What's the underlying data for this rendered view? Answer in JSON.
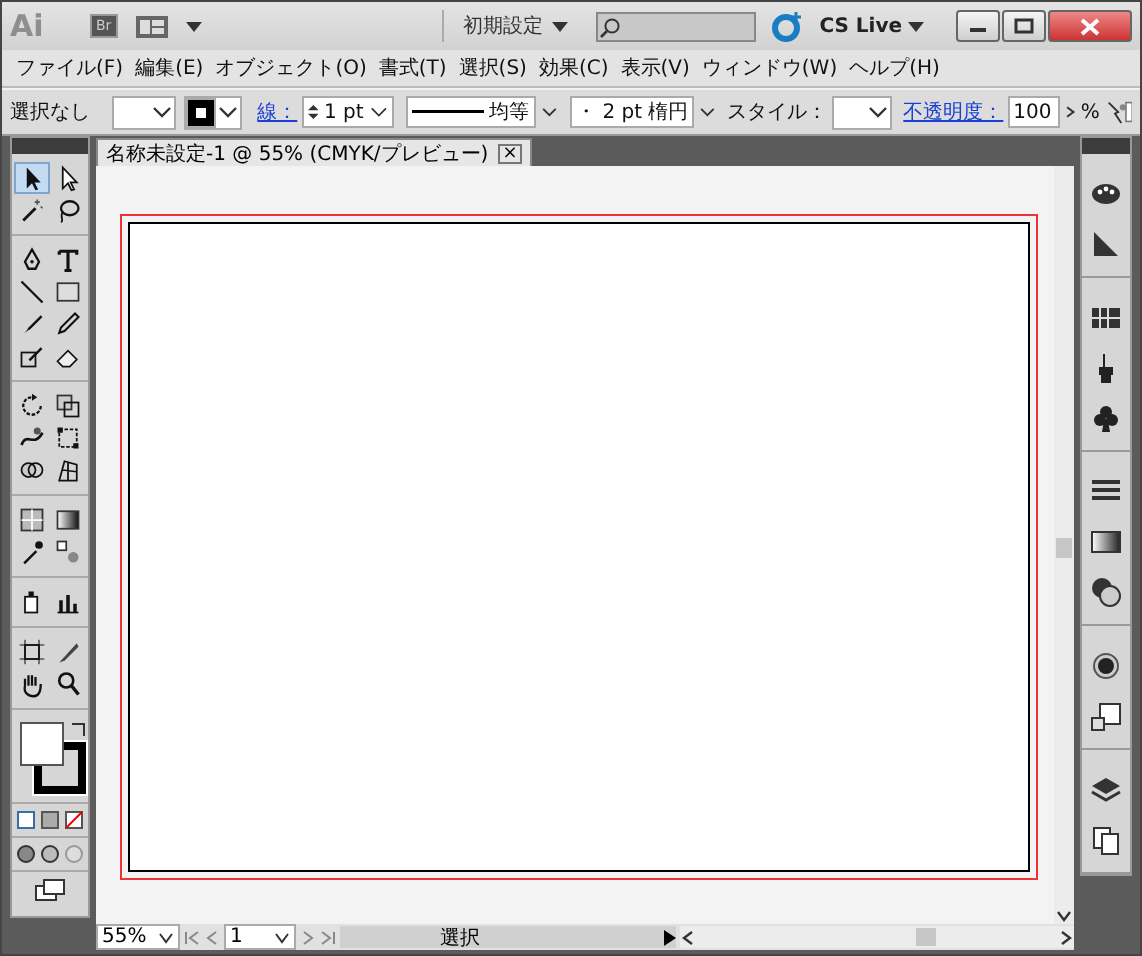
{
  "title_bar": {
    "logo": "Ai",
    "bridge": "Br",
    "workspace": "初期設定",
    "cs_live": "CS Live"
  },
  "menu": [
    "ファイル(F)",
    "編集(E)",
    "オブジェクト(O)",
    "書式(T)",
    "選択(S)",
    "効果(C)",
    "表示(V)",
    "ウィンドウ(W)",
    "ヘルプ(H)"
  ],
  "control_bar": {
    "selection": "選択なし",
    "stroke_link": "線：",
    "stroke_weight": "1 pt",
    "profile": "均等",
    "brush": "・  2 pt 楕円",
    "style_label": "スタイル：",
    "opacity_link": "不透明度：",
    "opacity": "100",
    "opacity_unit": "%"
  },
  "document_tab": {
    "title": "名称未設定-1 @ 55% (CMYK/プレビュー)",
    "close": "×"
  },
  "tool_groups": [
    [
      {
        "kind": "selection",
        "selected": true
      },
      {
        "kind": "direct",
        "selected": false
      },
      {
        "kind": "wand",
        "selected": false
      },
      {
        "kind": "lasso",
        "selected": false
      }
    ],
    [
      {
        "kind": "pen",
        "selected": false
      },
      {
        "kind": "type",
        "selected": false
      },
      {
        "kind": "line",
        "selected": false
      },
      {
        "kind": "rect",
        "selected": false
      },
      {
        "kind": "brush",
        "selected": false
      },
      {
        "kind": "pencil",
        "selected": false
      },
      {
        "kind": "blob",
        "selected": false
      },
      {
        "kind": "eraser",
        "selected": false
      }
    ],
    [
      {
        "kind": "rotate",
        "selected": false
      },
      {
        "kind": "scale",
        "selected": false
      },
      {
        "kind": "warp",
        "selected": false
      },
      {
        "kind": "transform",
        "selected": false
      },
      {
        "kind": "builder",
        "selected": false
      },
      {
        "kind": "perspective",
        "selected": false
      }
    ],
    [
      {
        "kind": "mesh",
        "selected": false
      },
      {
        "kind": "gradient",
        "selected": false
      },
      {
        "kind": "eyedropper",
        "selected": false
      },
      {
        "kind": "blend",
        "selected": false
      }
    ],
    [
      {
        "kind": "sprayer",
        "selected": false
      },
      {
        "kind": "graph",
        "selected": false
      }
    ],
    [
      {
        "kind": "artboard",
        "selected": false
      },
      {
        "kind": "slice",
        "selected": false
      },
      {
        "kind": "hand",
        "selected": false
      },
      {
        "kind": "zoom",
        "selected": false
      }
    ]
  ],
  "dock_groups": [
    [
      {
        "kind": "palette"
      },
      {
        "kind": "gradient-panel"
      }
    ],
    [
      {
        "kind": "swatches"
      },
      {
        "kind": "brushes"
      },
      {
        "kind": "symbols"
      }
    ],
    [
      {
        "kind": "stroke"
      },
      {
        "kind": "gradient-swatch"
      },
      {
        "kind": "transparency"
      }
    ],
    [
      {
        "kind": "appearance"
      },
      {
        "kind": "styles"
      }
    ],
    [
      {
        "kind": "layers"
      },
      {
        "kind": "artboards"
      }
    ]
  ],
  "status_bar": {
    "zoom": "55%",
    "page": "1",
    "status": "選択"
  }
}
